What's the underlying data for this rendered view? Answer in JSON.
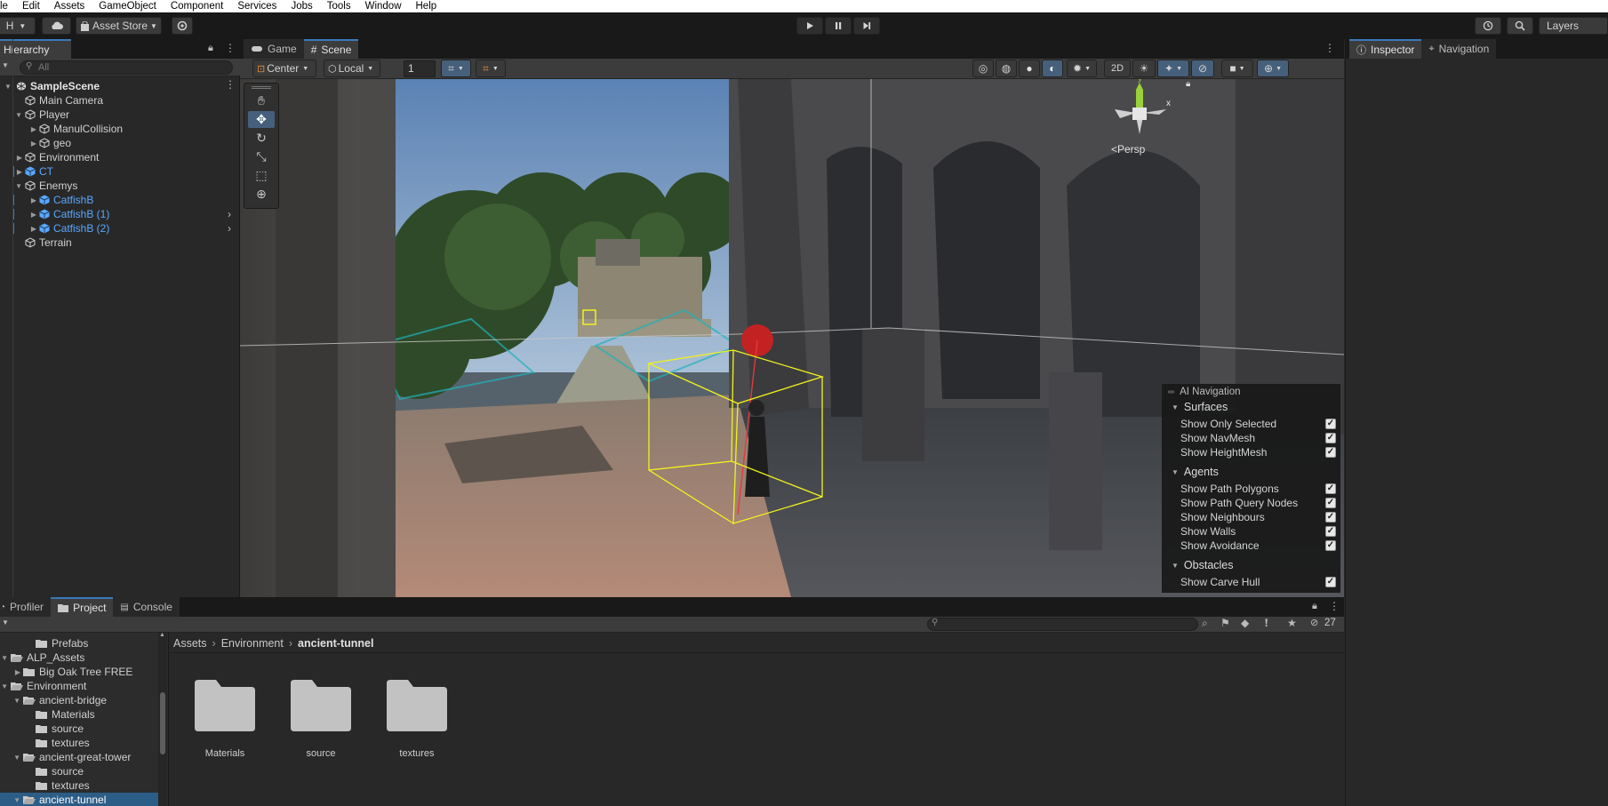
{
  "menu": [
    "le",
    "Edit",
    "Assets",
    "GameObject",
    "Component",
    "Services",
    "Jobs",
    "Tools",
    "Window",
    "Help"
  ],
  "toolbar": {
    "account_label": "H",
    "asset_store_label": "Asset Store",
    "layers_label": "Layers",
    "play_icon": "play-icon",
    "pause_icon": "pause-icon",
    "step_icon": "step-icon"
  },
  "hierarchy": {
    "tab_label": "Hierarchy",
    "search_placeholder": "All",
    "scene_name": "SampleScene",
    "items": [
      {
        "label": "Main Camera",
        "depth": 1
      },
      {
        "label": "Player",
        "depth": 1
      },
      {
        "label": "ManulCollision",
        "depth": 2
      },
      {
        "label": "geo",
        "depth": 2
      },
      {
        "label": "Environment",
        "depth": 1
      },
      {
        "label": "CT",
        "depth": 1,
        "prefab": true
      },
      {
        "label": "Enemys",
        "depth": 1
      },
      {
        "label": "CatfishB",
        "depth": 2,
        "prefab": true
      },
      {
        "label": "CatfishB (1)",
        "depth": 2,
        "prefab": true
      },
      {
        "label": "CatfishB (2)",
        "depth": 2,
        "prefab": true
      },
      {
        "label": "Terrain",
        "depth": 1
      }
    ]
  },
  "scene": {
    "tabs": [
      {
        "label": "Game"
      },
      {
        "label": "Scene"
      }
    ],
    "pivot_label": "Center",
    "space_label": "Local",
    "grid_value": "1",
    "mode_2d_label": "2D",
    "persp_label": "<Persp",
    "gizmo_y": "y",
    "gizmo_x": "x"
  },
  "ai_navigation": {
    "title": "AI Navigation",
    "sections": [
      {
        "label": "Surfaces",
        "options": [
          {
            "label": "Show Only Selected",
            "checked": true
          },
          {
            "label": "Show NavMesh",
            "checked": true
          },
          {
            "label": "Show HeightMesh",
            "checked": true
          }
        ]
      },
      {
        "label": "Agents",
        "options": [
          {
            "label": "Show Path Polygons",
            "checked": true
          },
          {
            "label": "Show Path Query Nodes",
            "checked": true
          },
          {
            "label": "Show Neighbours",
            "checked": true
          },
          {
            "label": "Show Walls",
            "checked": true
          },
          {
            "label": "Show Avoidance",
            "checked": true
          }
        ]
      },
      {
        "label": "Obstacles",
        "options": [
          {
            "label": "Show Carve Hull",
            "checked": true
          }
        ]
      }
    ]
  },
  "inspector": {
    "tabs": [
      {
        "label": "Inspector"
      },
      {
        "label": "Navigation"
      }
    ]
  },
  "bottom": {
    "tabs": [
      {
        "label": "Profiler"
      },
      {
        "label": "Project"
      },
      {
        "label": "Console"
      }
    ],
    "hidden_count": "27"
  },
  "project": {
    "tree": [
      {
        "label": "Prefabs",
        "depth": 2
      },
      {
        "label": "ALP_Assets",
        "depth": 0,
        "open": true
      },
      {
        "label": "Big Oak Tree FREE",
        "depth": 1
      },
      {
        "label": "Environment",
        "depth": 0,
        "open": true
      },
      {
        "label": "ancient-bridge",
        "depth": 1,
        "open": true
      },
      {
        "label": "Materials",
        "depth": 2
      },
      {
        "label": "source",
        "depth": 2
      },
      {
        "label": "textures",
        "depth": 2
      },
      {
        "label": "ancient-great-tower",
        "depth": 1,
        "open": true
      },
      {
        "label": "source",
        "depth": 2
      },
      {
        "label": "textures",
        "depth": 2
      },
      {
        "label": "ancient-tunnel",
        "depth": 1,
        "open": true,
        "selected": true
      }
    ],
    "breadcrumb": [
      "Assets",
      "Environment",
      "ancient-tunnel"
    ],
    "assets": [
      {
        "label": "Materials"
      },
      {
        "label": "source"
      },
      {
        "label": "textures"
      }
    ]
  },
  "colors": {
    "accent": "#3a79bb",
    "selection": "#2c5d87",
    "prefab_blue": "#5aa7ff",
    "bounding_box": "#f2f21c",
    "navmesh": "#1fb0bb"
  }
}
